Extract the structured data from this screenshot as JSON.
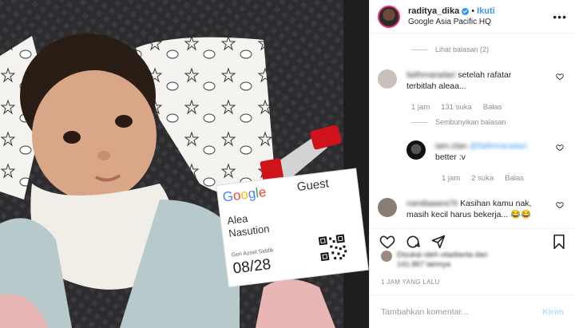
{
  "post": {
    "photo": {
      "badge_brand": "Google",
      "badge_type": "Guest",
      "badge_name_line1": "Alea",
      "badge_name_line2": "Nasution",
      "badge_host": "Geri Azriel Siddik",
      "badge_date": "08/28"
    },
    "header": {
      "username": "raditya_dika",
      "separator": "•",
      "follow_label": "Ikuti",
      "location": "Google Asia Pacific HQ",
      "more_label": "•••"
    },
    "comments": {
      "view_replies_label": "Lihat balasan (2)",
      "items": [
        {
          "username": "faithmaradari",
          "text_line1": "setelah rafatar",
          "text_line2": "terbitlah aleaa...",
          "time": "1 jam",
          "likes": "131 suka",
          "reply_label": "Balas"
        }
      ],
      "hide_replies_label": "Sembunyikan balasan",
      "reply": {
        "username": "iam.ctan",
        "mention": "@faithmaradari",
        "text": "better :v",
        "time": "1 jam",
        "likes": "2 suka",
        "reply_label": "Balas"
      },
      "third": {
        "username": "nandiaaara76",
        "text_line1": "Kasihan kamu nak,",
        "text_line2": "masih kecil harus bekerja... 😂😂"
      }
    },
    "likes": {
      "line1": "Disukai oleh vitadianta dan",
      "line2": "141.867 lainnya"
    },
    "timestamp": "1 JAM YANG LALU",
    "add_comment": {
      "placeholder": "Tambahkan komentar...",
      "post_label": "Kirim"
    },
    "colors": {
      "link_blue": "#3897f0",
      "muted": "#8e8e8e",
      "badge_red": "#d0131b"
    }
  }
}
